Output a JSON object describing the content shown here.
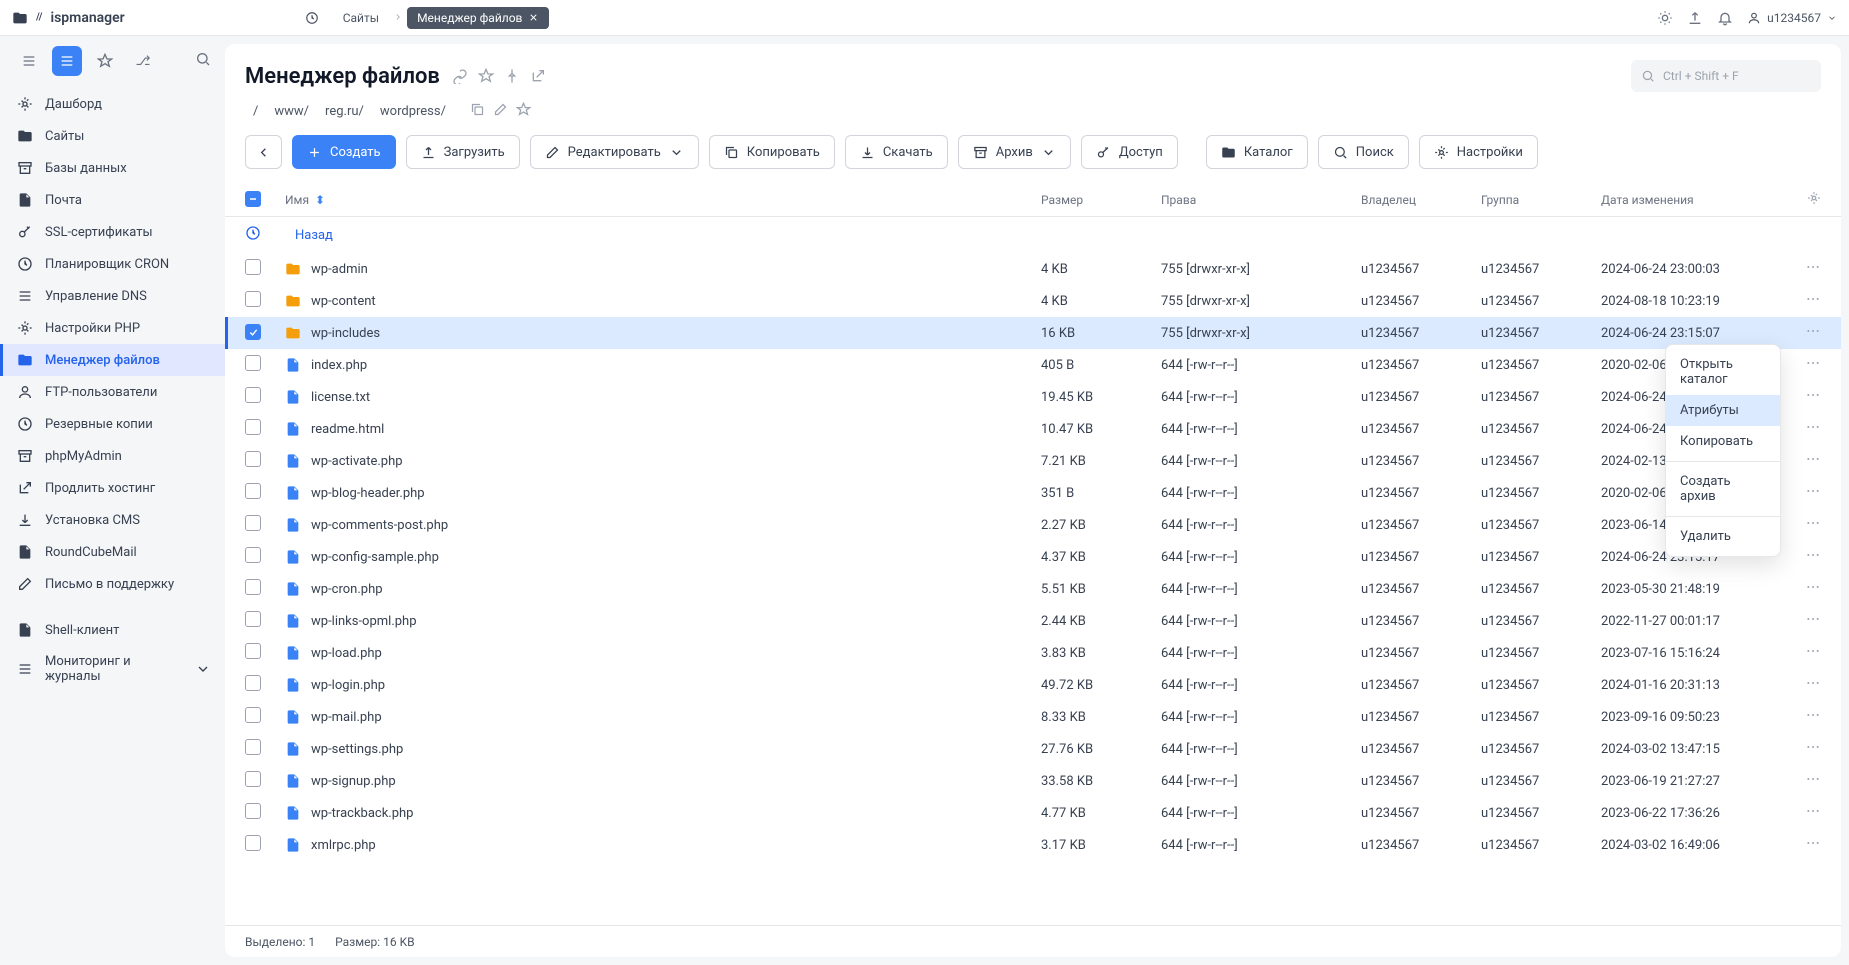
{
  "brand": "ispmanager",
  "tabs": {
    "sites": "Сайты",
    "fm": "Менеджер файлов"
  },
  "user": "u1234567",
  "nav": [
    {
      "icon": "dashboard",
      "label": "Дашборд"
    },
    {
      "icon": "globe",
      "label": "Сайты"
    },
    {
      "icon": "db",
      "label": "Базы данных"
    },
    {
      "icon": "mail",
      "label": "Почта"
    },
    {
      "icon": "lock",
      "label": "SSL-сертификаты"
    },
    {
      "icon": "clock",
      "label": "Планировщик CRON"
    },
    {
      "icon": "dns",
      "label": "Управление DNS"
    },
    {
      "icon": "php",
      "label": "Настройки PHP"
    },
    {
      "icon": "folder",
      "label": "Менеджер файлов",
      "active": true
    },
    {
      "icon": "users",
      "label": "FTP-пользователи"
    },
    {
      "icon": "backup",
      "label": "Резервные копии"
    },
    {
      "icon": "pma",
      "label": "phpMyAdmin"
    },
    {
      "icon": "renew",
      "label": "Продлить хостинг"
    },
    {
      "icon": "cms",
      "label": "Установка CMS"
    },
    {
      "icon": "rc",
      "label": "RoundCubeMail"
    },
    {
      "icon": "support",
      "label": "Письмо в поддержку"
    },
    {
      "icon": "shell",
      "label": "Shell-клиент"
    },
    {
      "icon": "monitor",
      "label": "Мониторинг и журналы",
      "expand": true
    }
  ],
  "page_title": "Менеджер файлов",
  "search_placeholder": "Ctrl + Shift + F",
  "crumbs": [
    "/",
    "www/",
    "reg.ru/",
    "wordpress/"
  ],
  "toolbar": {
    "create": "Создать",
    "upload": "Загрузить",
    "edit": "Редактировать",
    "copy": "Копировать",
    "download": "Скачать",
    "archive": "Архив",
    "access": "Доступ",
    "catalog": "Каталог",
    "search": "Поиск",
    "settings": "Настройки"
  },
  "columns": {
    "name": "Имя",
    "size": "Размер",
    "perm": "Права",
    "owner": "Владелец",
    "group": "Группа",
    "date": "Дата изменения"
  },
  "back_label": "Назад",
  "files": [
    {
      "t": "d",
      "n": "wp-admin",
      "s": "4 KB",
      "p": "755 [drwxr-xr-x]",
      "o": "u1234567",
      "g": "u1234567",
      "d": "2024-06-24 23:00:03"
    },
    {
      "t": "d",
      "n": "wp-content",
      "s": "4 KB",
      "p": "755 [drwxr-xr-x]",
      "o": "u1234567",
      "g": "u1234567",
      "d": "2024-08-18 10:23:19"
    },
    {
      "t": "d",
      "n": "wp-includes",
      "s": "16 KB",
      "p": "755 [drwxr-xr-x]",
      "o": "u1234567",
      "g": "u1234567",
      "d": "2024-06-24 23:15:07",
      "sel": true
    },
    {
      "t": "f",
      "n": "index.php",
      "s": "405 B",
      "p": "644 [-rw-r--r--]",
      "o": "u1234567",
      "g": "u1234567",
      "d": "2020-02-06 09:33:11"
    },
    {
      "t": "f",
      "n": "license.txt",
      "s": "19.45 KB",
      "p": "644 [-rw-r--r--]",
      "o": "u1234567",
      "g": "u1234567",
      "d": "2024-06-24 23:14:56"
    },
    {
      "t": "f",
      "n": "readme.html",
      "s": "10.47 KB",
      "p": "644 [-rw-r--r--]",
      "o": "u1234567",
      "g": "u1234567",
      "d": "2024-06-24 23:15:17"
    },
    {
      "t": "f",
      "n": "wp-activate.php",
      "s": "7.21 KB",
      "p": "644 [-rw-r--r--]",
      "o": "u1234567",
      "g": "u1234567",
      "d": "2024-02-13 17:19:09"
    },
    {
      "t": "f",
      "n": "wp-blog-header.php",
      "s": "351 B",
      "p": "644 [-rw-r--r--]",
      "o": "u1234567",
      "g": "u1234567",
      "d": "2020-02-06 09:33:11"
    },
    {
      "t": "f",
      "n": "wp-comments-post.php",
      "s": "2.27 KB",
      "p": "644 [-rw-r--r--]",
      "o": "u1234567",
      "g": "u1234567",
      "d": "2023-06-14 17:11:16"
    },
    {
      "t": "f",
      "n": "wp-config-sample.php",
      "s": "4.37 KB",
      "p": "644 [-rw-r--r--]",
      "o": "u1234567",
      "g": "u1234567",
      "d": "2024-06-24 23:15:17"
    },
    {
      "t": "f",
      "n": "wp-cron.php",
      "s": "5.51 KB",
      "p": "644 [-rw-r--r--]",
      "o": "u1234567",
      "g": "u1234567",
      "d": "2023-05-30 21:48:19"
    },
    {
      "t": "f",
      "n": "wp-links-opml.php",
      "s": "2.44 KB",
      "p": "644 [-rw-r--r--]",
      "o": "u1234567",
      "g": "u1234567",
      "d": "2022-11-27 00:01:17"
    },
    {
      "t": "f",
      "n": "wp-load.php",
      "s": "3.83 KB",
      "p": "644 [-rw-r--r--]",
      "o": "u1234567",
      "g": "u1234567",
      "d": "2023-07-16 15:16:24"
    },
    {
      "t": "f",
      "n": "wp-login.php",
      "s": "49.72 KB",
      "p": "644 [-rw-r--r--]",
      "o": "u1234567",
      "g": "u1234567",
      "d": "2024-01-16 20:31:13"
    },
    {
      "t": "f",
      "n": "wp-mail.php",
      "s": "8.33 KB",
      "p": "644 [-rw-r--r--]",
      "o": "u1234567",
      "g": "u1234567",
      "d": "2023-09-16 09:50:23"
    },
    {
      "t": "f",
      "n": "wp-settings.php",
      "s": "27.76 KB",
      "p": "644 [-rw-r--r--]",
      "o": "u1234567",
      "g": "u1234567",
      "d": "2024-03-02 13:47:15"
    },
    {
      "t": "f",
      "n": "wp-signup.php",
      "s": "33.58 KB",
      "p": "644 [-rw-r--r--]",
      "o": "u1234567",
      "g": "u1234567",
      "d": "2023-06-19 21:27:27"
    },
    {
      "t": "f",
      "n": "wp-trackback.php",
      "s": "4.77 KB",
      "p": "644 [-rw-r--r--]",
      "o": "u1234567",
      "g": "u1234567",
      "d": "2023-06-22 17:36:26"
    },
    {
      "t": "f",
      "n": "xmlrpc.php",
      "s": "3.17 KB",
      "p": "644 [-rw-r--r--]",
      "o": "u1234567",
      "g": "u1234567",
      "d": "2024-03-02 16:49:06"
    }
  ],
  "footer": {
    "selected": "Выделено: 1",
    "size": "Размер: 16 KB"
  },
  "ctx": [
    "Открыть каталог",
    "Атрибуты",
    "Копировать",
    "Создать архив",
    "Удалить"
  ]
}
